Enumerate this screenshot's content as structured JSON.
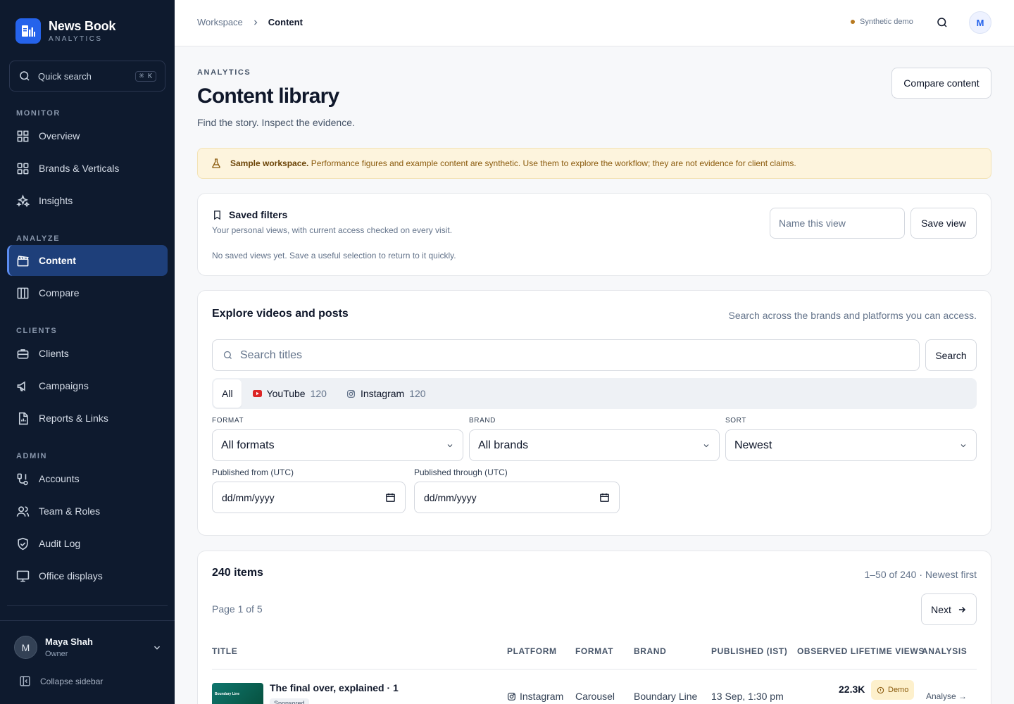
{
  "sidebar": {
    "brand_name": "News Book",
    "brand_sub": "ANALYTICS",
    "quick_search": "Quick search",
    "quick_search_kbd": "⌘ K",
    "sections": {
      "monitor": "MONITOR",
      "analyze": "ANALYZE",
      "clients": "CLIENTS",
      "admin": "ADMIN"
    },
    "items": {
      "overview": "Overview",
      "brands": "Brands & Verticals",
      "insights": "Insights",
      "content": "Content",
      "compare": "Compare",
      "clients": "Clients",
      "campaigns": "Campaigns",
      "reports": "Reports & Links",
      "accounts": "Accounts",
      "team": "Team & Roles",
      "audit": "Audit Log",
      "displays": "Office displays"
    },
    "active_item": "Content",
    "user": {
      "initial": "M",
      "name": "Maya Shah",
      "role": "Owner"
    },
    "collapse_label": "Collapse sidebar"
  },
  "topbar": {
    "breadcrumb": [
      "Workspace",
      "Content"
    ],
    "demo_label": "Synthetic demo",
    "avatar_initial": "M"
  },
  "page": {
    "eyebrow": "ANALYTICS",
    "title": "Content library",
    "subtitle": "Find the story. Inspect the evidence.",
    "compare_button": "Compare content"
  },
  "banner": {
    "strong": "Sample workspace.",
    "text": "Performance figures and example content are synthetic. Use them to explore the workflow; they are not evidence for client claims."
  },
  "saved_filters": {
    "title": "Saved filters",
    "description": "Your personal views, with current access checked on every visit.",
    "empty": "No saved views yet. Save a useful selection to return to it quickly.",
    "name_placeholder": "Name this view",
    "save_button": "Save view"
  },
  "explore": {
    "title": "Explore videos and posts",
    "hint": "Search across the brands and platforms you can access.",
    "search_placeholder": "Search titles",
    "search_button": "Search",
    "tabs": [
      {
        "label": "All",
        "count": ""
      },
      {
        "label": "YouTube",
        "count": "120"
      },
      {
        "label": "Instagram",
        "count": "120"
      }
    ],
    "active_tab": "All",
    "filters": {
      "format_label": "FORMAT",
      "format_value": "All formats",
      "brand_label": "BRAND",
      "brand_value": "All brands",
      "sort_label": "SORT",
      "sort_value": "Newest",
      "from_label": "Published from (UTC)",
      "from_value": "dd/mm/yyyy",
      "through_label": "Published through (UTC)",
      "through_value": "dd/mm/yyyy"
    }
  },
  "results": {
    "count_label": "240 items",
    "range_label": "1–50 of 240 · Newest first",
    "page_label": "Page 1 of 5",
    "next_button": "Next",
    "columns": [
      "TITLE",
      "PLATFORM",
      "FORMAT",
      "BRAND",
      "PUBLISHED (IST)",
      "OBSERVED LIFETIME VIEWS",
      "ANALYSIS"
    ],
    "rows": [
      {
        "thumb_text": "Boundary Line",
        "title": "The final over, explained · 1",
        "tag": "Sponsored",
        "platform": "Instagram",
        "format": "Carousel",
        "brand": "Boundary Line",
        "published": "13 Sep, 1:30 pm",
        "views": "22.3K",
        "badge": "Demo",
        "analysis": "Analyse →"
      }
    ]
  },
  "colors": {
    "sidebar_bg": "#0e1a2e",
    "accent": "#2563eb",
    "active_nav": "#1e3f7a",
    "banner_bg": "#fdf4dd",
    "youtube": "#dc2626"
  }
}
